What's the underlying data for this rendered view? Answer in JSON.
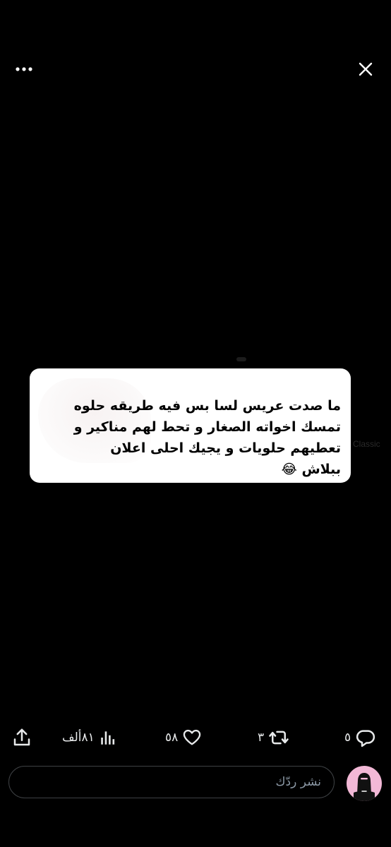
{
  "header": {
    "more_icon": "more-horizontal-icon",
    "close_icon": "close-icon"
  },
  "media": {
    "background_text": "Classic",
    "card": {
      "lines": [
        "ما صدت عريس لسا بس فيه طريقه حلوه",
        "تمسك اخواته الصغار و تحط لهم مناكير و",
        "تعطيهم حلويات و يجيك احلى اعلان",
        "ببلاش 😂"
      ]
    }
  },
  "actions": {
    "reply_count": "٥",
    "reply_icon": "reply-bubble-icon",
    "retweet_count": "٣",
    "retweet_icon": "retweet-icon",
    "like_count": "٥٨",
    "like_icon": "heart-icon",
    "views_count": "٨١ألف",
    "views_icon": "analytics-icon",
    "share_icon": "share-icon"
  },
  "reply_bar": {
    "placeholder": "نشر ردّك",
    "avatar_color": "#f2b8d6"
  },
  "colors": {
    "background": "#000000",
    "icon": "#e7e9ea",
    "placeholder": "#8b98a5",
    "border": "#3e4144"
  }
}
